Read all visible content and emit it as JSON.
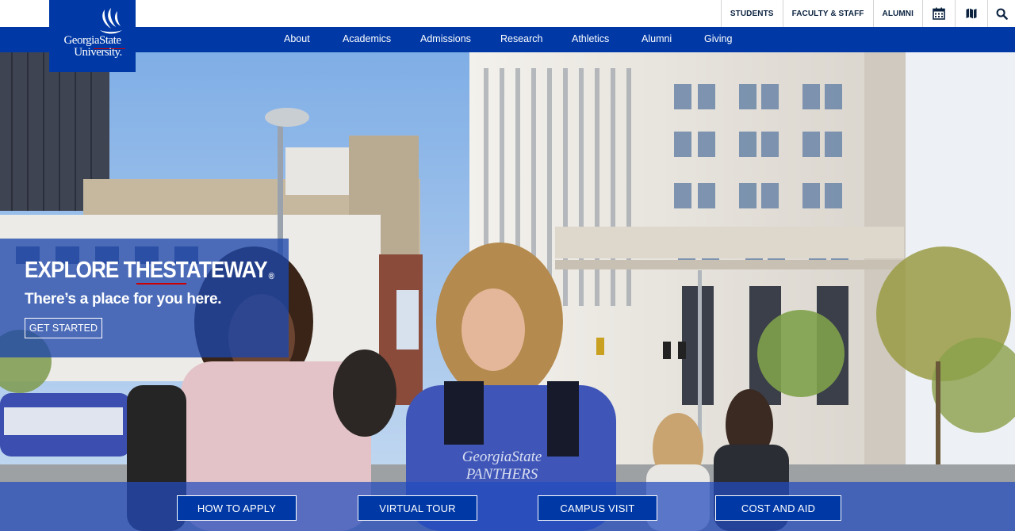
{
  "utility": {
    "links": [
      "STUDENTS",
      "FACULTY & STAFF",
      "ALUMNI"
    ],
    "icons": [
      "calendar-icon",
      "map-icon",
      "search-icon"
    ]
  },
  "logo": {
    "line1": "GeorgiaState",
    "line2": "University."
  },
  "nav": {
    "items": [
      "About",
      "Academics",
      "Admissions",
      "Research",
      "Athletics",
      "Alumni",
      "Giving"
    ]
  },
  "hero": {
    "title": "EXPLORE THESTATEWAY",
    "title_mark": "®",
    "subtitle": "There’s a place for you here.",
    "cta": "GET STARTED",
    "sweatshirt_text": "GeorgiaState PANTHERS"
  },
  "actions": [
    "HOW TO APPLY",
    "VIRTUAL TOUR",
    "CAMPUS VISIT",
    "COST AND AID"
  ],
  "colors": {
    "brand_blue": "#0039a6",
    "accent_red": "#cc0000",
    "navy": "#0c2340"
  }
}
